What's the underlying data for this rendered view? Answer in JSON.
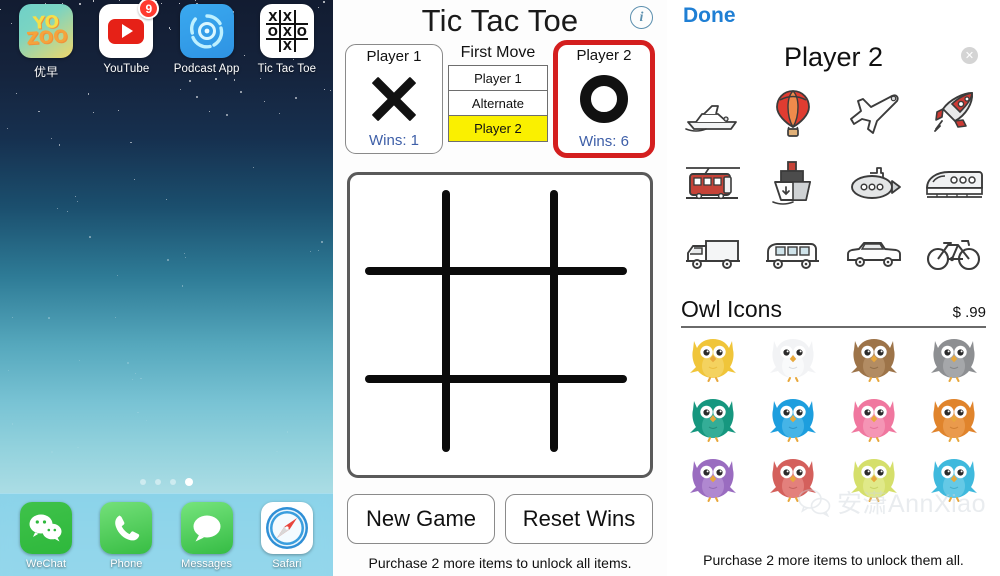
{
  "home": {
    "apps": [
      {
        "label": "优早",
        "icon": "yozoo-icon",
        "badge": null
      },
      {
        "label": "YouTube",
        "icon": "youtube-icon",
        "badge": "9"
      },
      {
        "label": "Podcast App",
        "icon": "podcast-icon",
        "badge": null
      },
      {
        "label": "Tic Tac Toe",
        "icon": "tictactoe-icon",
        "badge": null
      }
    ],
    "tictactoe_icon_cells": [
      "X",
      "X",
      "",
      "O",
      "X",
      "O",
      "",
      "X",
      ""
    ],
    "page_dots": {
      "count": 4,
      "active_index": 3
    },
    "dock": [
      {
        "label": "WeChat",
        "icon": "wechat-icon"
      },
      {
        "label": "Phone",
        "icon": "phone-icon"
      },
      {
        "label": "Messages",
        "icon": "messages-icon"
      },
      {
        "label": "Safari",
        "icon": "safari-icon"
      }
    ]
  },
  "game": {
    "title": "Tic Tac Toe",
    "info_icon": "info-icon",
    "player1": {
      "name": "Player 1",
      "mark": "X",
      "wins_label": "Wins: 1",
      "active": false
    },
    "player2": {
      "name": "Player 2",
      "mark": "O",
      "wins_label": "Wins: 6",
      "active": true
    },
    "first_move": {
      "label": "First Move",
      "options": [
        "Player 1",
        "Alternate",
        "Player 2"
      ],
      "selected": "Player 2"
    },
    "board_cells": [
      "",
      "",
      "",
      "",
      "",
      "",
      "",
      "",
      ""
    ],
    "buttons": {
      "new_game": "New Game",
      "reset_wins": "Reset Wins"
    },
    "purchase_note": "Purchase 2 more items to unlock all items.",
    "colors": {
      "active_border": "#d41f1f",
      "selected_fill": "#faf000",
      "wins_text": "#3e5fa8"
    }
  },
  "store": {
    "done_label": "Done",
    "title": "Player 2",
    "clear_icon": "clear-circle-icon",
    "transport_icons": [
      [
        "speedboat-icon",
        "hot-air-balloon-icon",
        "airplane-icon",
        "rocket-icon"
      ],
      [
        "tram-icon",
        "ship-icon",
        "submarine-icon",
        "bullet-train-icon"
      ],
      [
        "box-truck-icon",
        "minibus-icon",
        "car-icon",
        "bicycle-icon"
      ]
    ],
    "section": {
      "title": "Owl Icons",
      "price": "$ .99"
    },
    "owl_rows": [
      [
        "owl-yellow",
        "owl-white",
        "owl-brown",
        "owl-grey"
      ],
      [
        "owl-teal",
        "owl-blue",
        "owl-pink",
        "owl-orange"
      ],
      [
        "owl-purple",
        "owl-red",
        "owl-lime",
        "owl-cyan"
      ]
    ],
    "purchase_note": "Purchase 2 more items to unlock them all.",
    "watermark": "安潇AnnXiao",
    "accent_color": "#1f7fd4"
  }
}
